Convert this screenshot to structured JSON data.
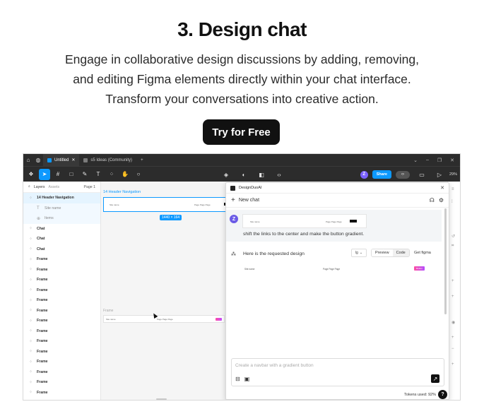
{
  "hero": {
    "title": "3. Design chat",
    "description_line1": "Engage in collaborative design discussions by adding, removing,",
    "description_line2": "and editing Figma elements directly within your chat interface.",
    "description_line3": "Transform your conversations into creative action.",
    "cta_label": "Try for Free"
  },
  "titlebar": {
    "tabs": [
      {
        "label": "Untitled",
        "close": "✕"
      },
      {
        "label": "s5 Ideas (Community)"
      }
    ],
    "new_tab": "+"
  },
  "toolbar": {
    "avatar_initial": "Z",
    "share_label": "Share",
    "zoom_label": "29%"
  },
  "layers": {
    "tab_layers": "Layers",
    "tab_assets": "Assets",
    "page_label": "Page 1",
    "items": [
      {
        "label": "14 Header Navigation"
      },
      {
        "label": "Site name"
      },
      {
        "label": "Items"
      },
      {
        "label": "Chat"
      },
      {
        "label": "Chat"
      },
      {
        "label": "Chat"
      },
      {
        "label": "Frame"
      },
      {
        "label": "Frame"
      },
      {
        "label": "Frame"
      },
      {
        "label": "Frame"
      },
      {
        "label": "Frame"
      },
      {
        "label": "Frame"
      },
      {
        "label": "Frame"
      },
      {
        "label": "Frame"
      },
      {
        "label": "Frame"
      },
      {
        "label": "Frame"
      },
      {
        "label": "Frame"
      },
      {
        "label": "Frame"
      },
      {
        "label": "Frame"
      },
      {
        "label": "Frame"
      }
    ]
  },
  "canvas": {
    "frame1_label": "14 Header Navigation",
    "frame1_site": "Site name",
    "frame1_links": "Page  Page  Page",
    "frame1_dims": "1440 × 164",
    "frame2_label": "Frame",
    "frame2_site": "Site name",
    "frame2_links": "Page  Page  Page"
  },
  "plugin": {
    "title": "DesignDuoAI",
    "new_chat": "New chat",
    "user_avatar": "Z",
    "user_message": "shift the links to the center and make the button gradient.",
    "user_preview_site": "Site name",
    "user_preview_links": "Page  Page  Page",
    "ai_message": "Here is the requested design",
    "lang_select": "lg",
    "tab_preview": "Preview",
    "tab_code": "Code",
    "get_figma": "Get figma",
    "ai_preview_site": "Site name",
    "ai_preview_links": "Page  Page  Page",
    "ai_preview_button": "Button",
    "composer_placeholder": "Create a navbar with a gradient button",
    "tokens_used": "Tokens used: 92%",
    "help": "?"
  }
}
